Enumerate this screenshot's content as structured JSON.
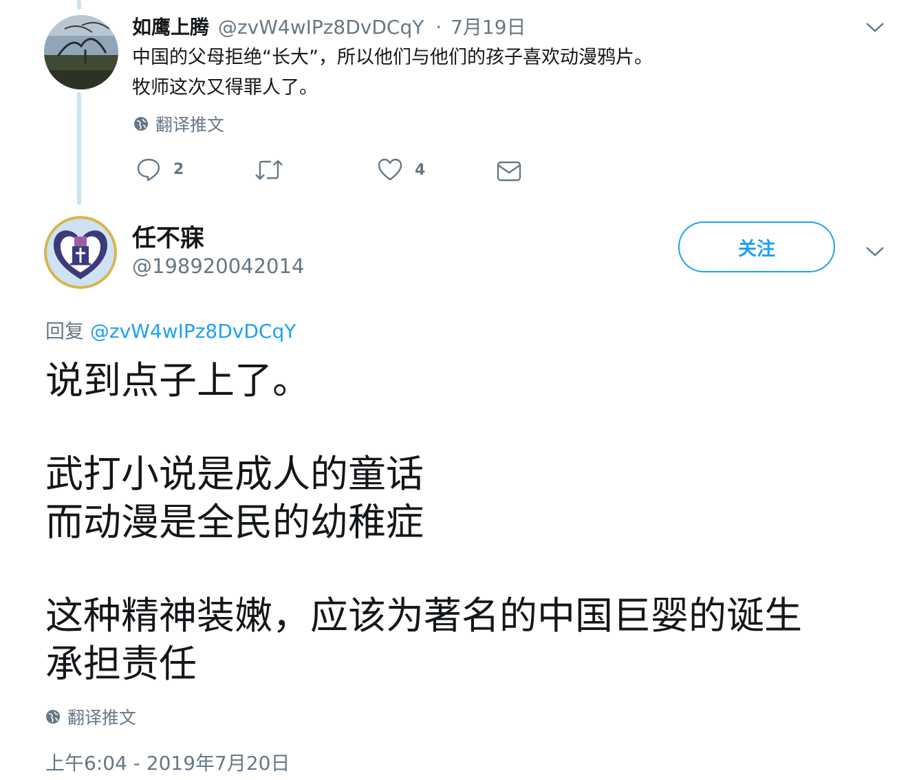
{
  "parent_tweet": {
    "author_name": "如鹰上腾",
    "handle": "@zvW4wIPz8DvDCqY",
    "separator": "·",
    "date": "7月19日",
    "text_lines": [
      "中国的父母拒绝“长大”，所以他们与他们的孩子喜欢动漫鸦片。",
      "牧师这次又得罪人了。"
    ],
    "translate_label": "翻译推文",
    "reply_count": "2",
    "like_count": "4"
  },
  "main_tweet": {
    "author_name": "任不寐",
    "handle": "@198920042014",
    "follow_label": "关注",
    "reply_prefix": "回复",
    "reply_to": "@zvW4wIPz8DvDCqY",
    "text_lines": [
      "说到点子上了。",
      "",
      "武打小说是成人的童话",
      "而动漫是全民的幼稚症",
      "",
      "这种精神装嫩，应该为著名的中国巨婴的诞生",
      "承担责任"
    ],
    "translate_label": "翻译推文",
    "timestamp": "上午6:04 - 2019年7月20日"
  },
  "colors": {
    "accent": "#1da1f2",
    "muted": "#657786",
    "thread_line": "#c7e3f5",
    "text": "#14171a"
  },
  "icons": [
    "reply-icon",
    "retweet-icon",
    "like-icon",
    "message-icon",
    "globe-icon",
    "chevron-down-icon",
    "crest-avatar",
    "landscape-avatar"
  ]
}
